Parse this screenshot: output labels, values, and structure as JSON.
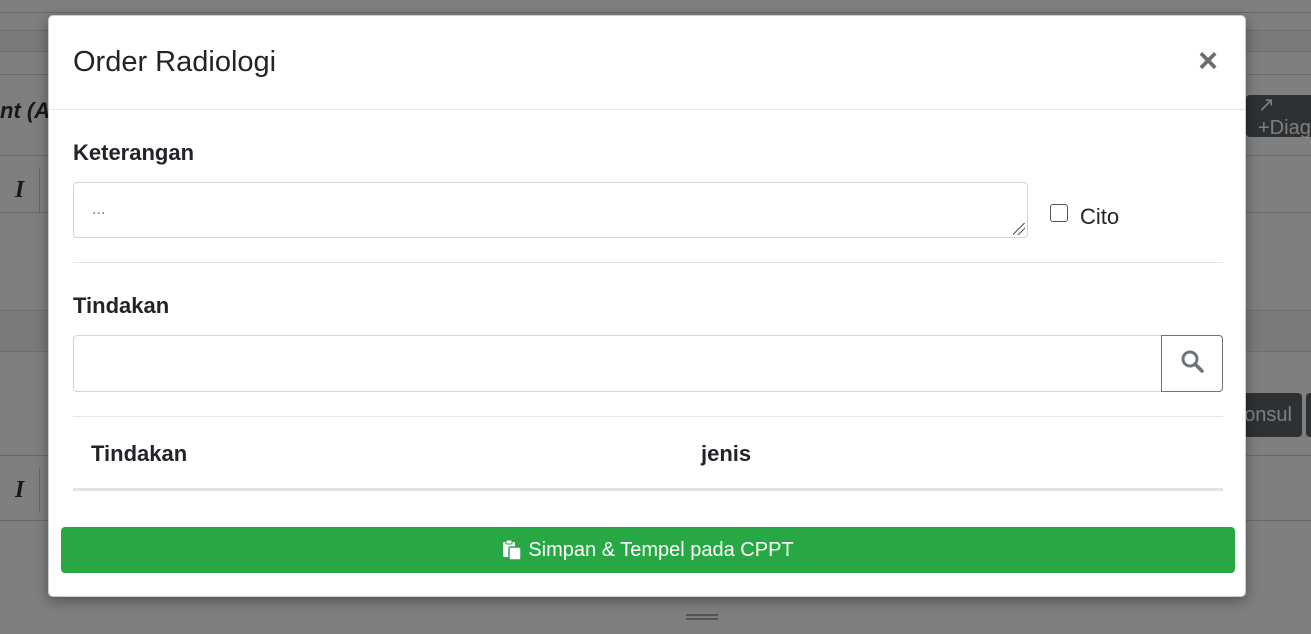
{
  "background": {
    "heading_fragment": "nt (A",
    "toolbar_italic": "I",
    "diag_button": "↗ +Diag",
    "konsul_button": "onsul"
  },
  "modal": {
    "title": "Order Radiologi",
    "close_symbol": "×",
    "keterangan": {
      "label": "Keterangan",
      "placeholder": "...",
      "value": ""
    },
    "cito": {
      "label": "Cito",
      "checked": false
    },
    "tindakan": {
      "label": "Tindakan",
      "search_value": "",
      "search_icon": "search-icon"
    },
    "table": {
      "columns": [
        "Tindakan",
        "jenis"
      ],
      "rows": []
    },
    "save_button": {
      "label": "Simpan & Tempel pada CPPT",
      "icon": "paste-icon"
    }
  },
  "colors": {
    "success": "#28a745",
    "overlay": "rgba(0,0,0,0.5)"
  }
}
